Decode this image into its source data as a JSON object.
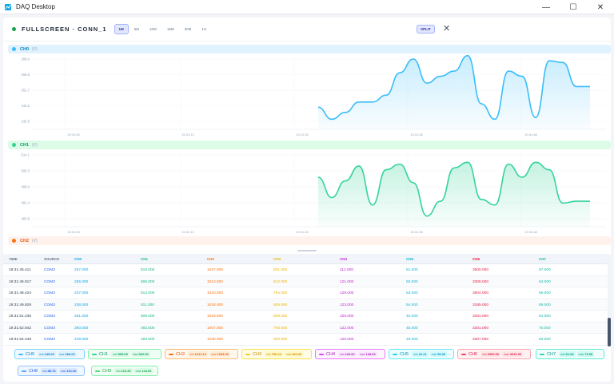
{
  "window": {
    "title": "DAQ Desktop",
    "minimize_glyph": "—",
    "maximize_glyph": "☐",
    "close_glyph": "✕"
  },
  "topbar": {
    "title": "FULLSCREEN · CONN_1",
    "ranges": [
      "1M",
      "5M",
      "10M",
      "15M",
      "30M",
      "1H"
    ],
    "active_range": "1M",
    "split_label": "SPLIT",
    "close_glyph": "✕"
  },
  "colors": {
    "ch0": "#38bdf8",
    "ch1": "#34d399",
    "ch2": "#f97316",
    "ch3": "#facc15",
    "ch4": "#d946ef",
    "ch5": "#22d3ee",
    "ch6": "#f43f5e",
    "ch7": "#2dd4bf",
    "ch8": "#60a5fa",
    "ch9": "#4ade80"
  },
  "charts": [
    {
      "name": "CH0",
      "unit": "(V)",
      "color": "#38bdf8",
      "yticks": [
        "268.0",
        "259.8",
        "251.7",
        "243.6",
        "235.5"
      ],
      "xticks": [
        "19:31:00",
        "19:31:12",
        "19:31:24",
        "19:31:36",
        "19:31:48"
      ]
    },
    {
      "name": "CH1",
      "unit": "(V)",
      "color": "#34d399",
      "yticks": [
        "514.1",
        "508.3",
        "499.0",
        "491.4",
        "483.8"
      ],
      "xticks": [
        "19:31:00",
        "19:31:12",
        "19:31:24",
        "19:31:36",
        "19:31:48"
      ]
    },
    {
      "name": "CH2",
      "unit": "(V)",
      "color": "#f97316"
    }
  ],
  "chart_data": [
    {
      "type": "line",
      "title": "CH0",
      "ylabel": "(V)",
      "x": [
        "19:31:45",
        "19:31:46",
        "19:31:47",
        "19:31:48",
        "19:31:49",
        "19:31:50",
        "19:31:51",
        "19:31:52",
        "19:31:53",
        "19:31:54",
        "19:31:55",
        "19:31:56",
        "19:31:57",
        "19:31:58",
        "19:31:59",
        "19:32:00",
        "19:32:01",
        "19:32:02",
        "19:32:03",
        "19:32:04",
        "19:32:05"
      ],
      "values": [
        243,
        236,
        240,
        246,
        246,
        250,
        263,
        271,
        257,
        261,
        264,
        273,
        245,
        236,
        264,
        261,
        237,
        270,
        269,
        255,
        255
      ],
      "ylim": [
        232,
        271
      ]
    },
    {
      "type": "line",
      "title": "CH1",
      "ylabel": "(V)",
      "x": [
        "19:31:45",
        "19:31:46",
        "19:31:47",
        "19:31:48",
        "19:31:49",
        "19:31:50",
        "19:31:51",
        "19:31:52",
        "19:31:53",
        "19:31:54",
        "19:31:55",
        "19:31:56",
        "19:31:57",
        "19:31:58",
        "19:31:59",
        "19:32:00",
        "19:32:01",
        "19:32:02",
        "19:32:03",
        "19:32:04",
        "19:32:05"
      ],
      "values": [
        505,
        494,
        503,
        511,
        490,
        509,
        512,
        502,
        484,
        492,
        510,
        513,
        493,
        490,
        512,
        505,
        513,
        509,
        491,
        492,
        492
      ],
      "ylim": [
        480,
        517
      ]
    }
  ],
  "table": {
    "headers": [
      "TIME",
      "SOURCE",
      "CH0",
      "CH1",
      "CH2",
      "CH3",
      "CH4",
      "CH5",
      "CH6",
      "CH7"
    ],
    "rows": [
      [
        "19:31:45.411",
        "COM3",
        "257.000",
        "510.000",
        "1027.000",
        "801.000",
        "112.000",
        "51.000",
        "3500.000",
        "67.000"
      ],
      [
        "19:31:46.917",
        "COM3",
        "255.000",
        "506.000",
        "1013.000",
        "812.000",
        "121.000",
        "50.000",
        "3305.000",
        "64.000"
      ],
      [
        "19:31:48.424",
        "COM3",
        "237.000",
        "513.000",
        "1020.000",
        "794.000",
        "129.000",
        "53.000",
        "3504.000",
        "65.000"
      ],
      [
        "19:31:49.929",
        "COM3",
        "238.000",
        "511.000",
        "1028.000",
        "805.000",
        "123.000",
        "54.000",
        "3285.000",
        "59.000"
      ],
      [
        "19:31:51.436",
        "COM3",
        "261.000",
        "509.000",
        "1018.000",
        "809.000",
        "109.000",
        "40.000",
        "3301.000",
        "54.000"
      ],
      [
        "19:31:52.942",
        "COM3",
        "260.000",
        "492.000",
        "1007.000",
        "794.000",
        "122.000",
        "45.000",
        "3301.000",
        "70.000"
      ],
      [
        "19:31:54.448",
        "COM3",
        "249.000",
        "493.000",
        "1030.000",
        "800.000",
        "120.000",
        "49.000",
        "3307.000",
        "56.000"
      ]
    ]
  },
  "chips": [
    {
      "name": "CH0",
      "min_label": "min",
      "min": "245.00",
      "max_label": "max",
      "max": "266.00"
    },
    {
      "name": "CH1",
      "min_label": "min",
      "min": "505.00",
      "max_label": "max",
      "max": "522.00"
    },
    {
      "name": "CH2",
      "min_label": "min",
      "min": "1011.13",
      "max_label": "max",
      "max": "1033.00"
    },
    {
      "name": "CH3",
      "min_label": "min",
      "min": "790.24",
      "max_label": "max",
      "max": "811.00"
    },
    {
      "name": "CH4",
      "min_label": "min",
      "min": "120.61",
      "max_label": "max",
      "max": "133.00"
    },
    {
      "name": "CH5",
      "min_label": "min",
      "min": "42.21",
      "max_label": "max",
      "max": "56.00"
    },
    {
      "name": "CH6",
      "min_label": "min",
      "min": "3300.00",
      "max_label": "max",
      "max": "3310.00"
    },
    {
      "name": "CH7",
      "min_label": "min",
      "min": "61.00",
      "max_label": "max",
      "max": "73.00"
    },
    {
      "name": "CH8",
      "min_label": "min",
      "min": "85.76",
      "max_label": "max",
      "max": "101.00"
    },
    {
      "name": "CH9",
      "min_label": "min",
      "min": "110.25",
      "max_label": "max",
      "max": "124.00"
    }
  ]
}
